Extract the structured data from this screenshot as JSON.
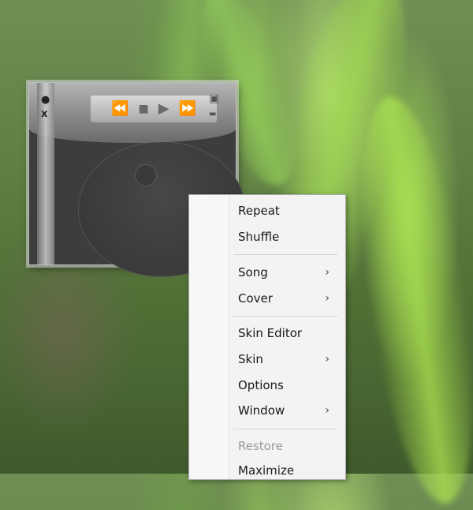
{
  "player": {
    "side_buttons": {
      "dot": "●",
      "close": "x"
    },
    "controls": {
      "rewind": "⏪",
      "stop": "■",
      "play": "▶",
      "forward": "⏩"
    },
    "right_buttons": {
      "maximize": "▣",
      "minimize": "▬"
    }
  },
  "menu": {
    "items": [
      {
        "label": "Repeat",
        "submenu": false,
        "disabled": false
      },
      {
        "label": "Shuffle",
        "submenu": false,
        "disabled": false
      },
      {
        "label": "Song",
        "submenu": true,
        "disabled": false
      },
      {
        "label": "Cover",
        "submenu": true,
        "disabled": false
      },
      {
        "label": "Skin Editor",
        "submenu": false,
        "disabled": false
      },
      {
        "label": "Skin",
        "submenu": true,
        "disabled": false
      },
      {
        "label": "Options",
        "submenu": false,
        "disabled": false
      },
      {
        "label": "Window",
        "submenu": true,
        "disabled": false
      },
      {
        "label": "Restore",
        "submenu": false,
        "disabled": true
      },
      {
        "label": "Maximize",
        "submenu": false,
        "disabled": false
      }
    ],
    "submenu_arrow": "›"
  },
  "colors": {
    "menu_background": "#f3f3f3",
    "menu_text": "#1a1a1a",
    "menu_disabled_text": "#9a9a9a",
    "player_body": "#3d3d3d"
  }
}
